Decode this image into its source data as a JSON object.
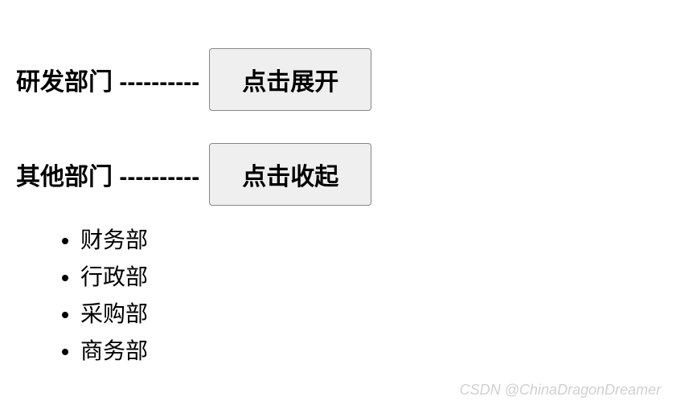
{
  "sections": [
    {
      "label": "研发部门 ----------",
      "button_label": "点击展开",
      "expanded": false,
      "items": []
    },
    {
      "label": "其他部门 ----------",
      "button_label": "点击收起",
      "expanded": true,
      "items": [
        "财务部",
        "行政部",
        "采购部",
        "商务部"
      ]
    }
  ],
  "watermark": "CSDN @ChinaDragonDreamer"
}
